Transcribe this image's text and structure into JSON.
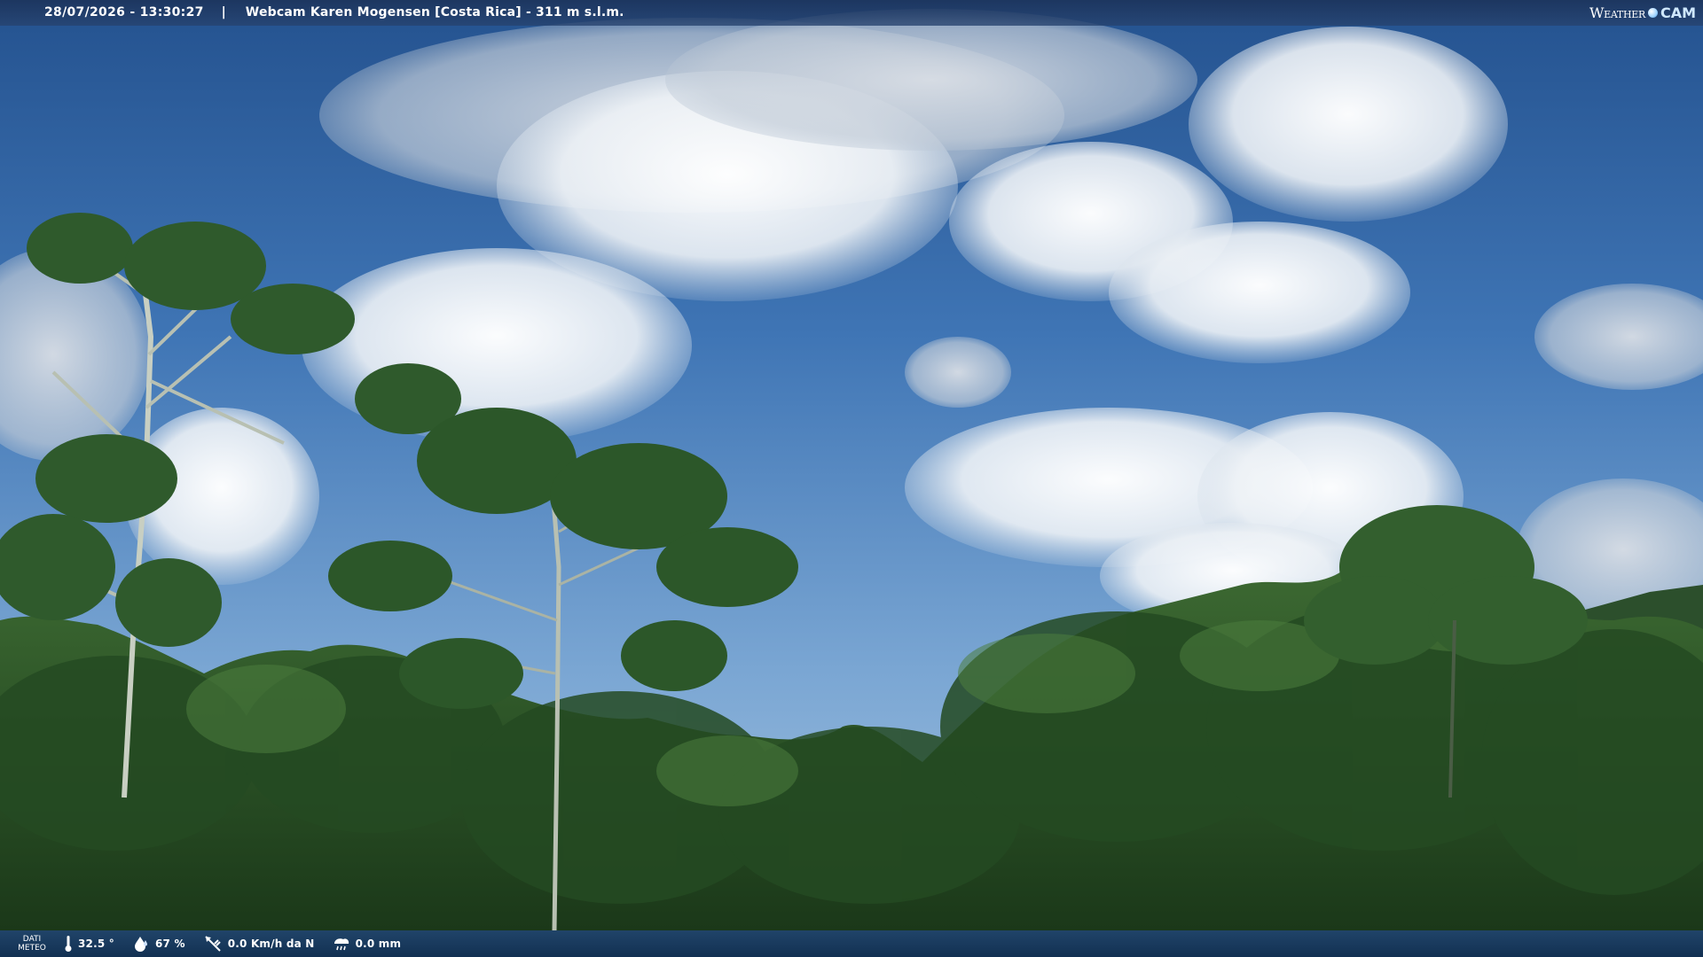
{
  "header": {
    "timestamp": "28/07/2026 - 13:30:27",
    "separator": "|",
    "title": "Webcam Karen Mogensen [Costa Rica] - 311 m s.l.m."
  },
  "logo": {
    "left_text": "Weather",
    "right_text": "CAM"
  },
  "footer": {
    "label": "DATI METEO",
    "temperature": "32.5 °",
    "humidity": "67 %",
    "wind": "0.0 Km/h da N",
    "rain": "0.0 mm"
  },
  "colors": {
    "sky_top": "#2a5a9a",
    "sky_mid": "#4a7fbf",
    "sky_low": "#8eb6dc",
    "foliage": "#2f5a2a",
    "bar": "#1a3a66"
  }
}
